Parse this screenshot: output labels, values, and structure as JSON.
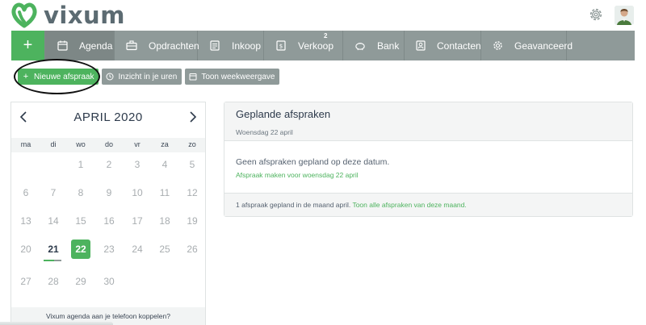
{
  "header": {
    "logo_text": "vixum",
    "icons": {
      "logo": "vixum-logo-icon",
      "settings": "gear-icon",
      "avatar": "user-avatar"
    }
  },
  "nav": {
    "plus": "+",
    "items": [
      {
        "label": "Agenda",
        "icon": "calendar-icon",
        "active": true
      },
      {
        "label": "Opdrachten",
        "icon": "briefcase-icon"
      },
      {
        "label": "Inkoop",
        "icon": "document-icon"
      },
      {
        "label": "Verkoop",
        "icon": "invoice-icon",
        "badge": "2"
      },
      {
        "label": "Bank",
        "icon": "piggy-bank-icon"
      },
      {
        "label": "Contacten",
        "icon": "contact-icon"
      },
      {
        "label": "Geavanceerd",
        "icon": "gear-icon"
      }
    ]
  },
  "toolbar": {
    "new_appointment": "Nieuwe afspraak",
    "hours_insight": "Inzicht in je uren",
    "week_view": "Toon weekweergave"
  },
  "calendar": {
    "title": "APRIL 2020",
    "weekdays": [
      "ma",
      "di",
      "wo",
      "do",
      "vr",
      "za",
      "zo"
    ],
    "weeks": [
      [
        "",
        "",
        "1",
        "2",
        "3",
        "4",
        "5"
      ],
      [
        "6",
        "7",
        "8",
        "9",
        "10",
        "11",
        "12"
      ],
      [
        "13",
        "14",
        "15",
        "16",
        "17",
        "18",
        "19"
      ],
      [
        "20",
        "21",
        "22",
        "23",
        "24",
        "25",
        "26"
      ],
      [
        "27",
        "28",
        "29",
        "30",
        "",
        "",
        ""
      ]
    ],
    "today": "21",
    "selected": "22",
    "footer": "Vixum agenda aan je telefoon koppelen?"
  },
  "appointments": {
    "title": "Geplande afspraken",
    "date": "Woensdag 22 april",
    "empty_text": "Geen afspraken gepland op deze datum.",
    "create_link": "Afspraak maken voor woensdag 22 april",
    "summary": "1 afspraak gepland in de maand april.",
    "show_all_link": "Toon alle afspraken van deze maand."
  },
  "colors": {
    "accent": "#4db35e",
    "nav": "#8f9a99",
    "text": "#2d3a4b"
  }
}
